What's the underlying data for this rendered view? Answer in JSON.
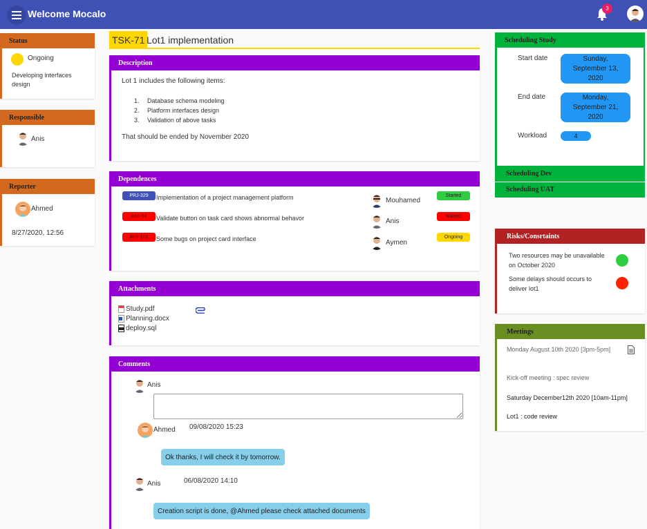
{
  "header": {
    "title": "Welcome Mocalo",
    "notification_count": "3"
  },
  "status": {
    "heading": "Status",
    "state": "Ongoing",
    "state_color": "#ffd700",
    "detail": "Developing interfaces design"
  },
  "responsible": {
    "heading": "Responsible",
    "name": "Anis"
  },
  "reporter": {
    "heading": "Reporter",
    "name": "Ahmed",
    "date": "8/27/2020, 12:56"
  },
  "task": {
    "id": "TSK-71",
    "name": "Lot1 implementation"
  },
  "description": {
    "heading": "Description",
    "intro": "Lot 1 includes the following items:",
    "items": [
      {
        "num": "1.",
        "text": "Database schema modeling"
      },
      {
        "num": "2.",
        "text": "Platform interfaces design"
      },
      {
        "num": "3.",
        "text": "Validation of above tasks"
      }
    ],
    "outro": "That should be ended by November 2020"
  },
  "dependences": {
    "heading": "Dependences",
    "rows": [
      {
        "code": "PRJ-329",
        "code_color": "#3f51b5",
        "text": "Implementation of a project management platform",
        "person": "Mouhamed",
        "status": "Started",
        "status_color": "#2ecc40"
      },
      {
        "code": "Ano-64",
        "code_color": "#ff0000",
        "text": "Validate button on task card shows abnormal behavor",
        "person": "Anis",
        "status": "Raised",
        "status_color": "#ff0000"
      },
      {
        "code": "Ano-101",
        "code_color": "#ff0000",
        "text": "Some bugs on project card interface",
        "person": "Aymen",
        "status": "Ongoing",
        "status_color": "#ffd700"
      }
    ]
  },
  "attachments": {
    "heading": "Attachments",
    "files": [
      {
        "name": "Study.pdf",
        "icon": "pdf-icon"
      },
      {
        "name": "Planning.docx",
        "icon": "docx-icon"
      },
      {
        "name": "deploy.sql",
        "icon": "sql-icon"
      }
    ]
  },
  "comments": {
    "heading": "Comments",
    "current_user": "Anis",
    "input_placeholder": "",
    "entries": [
      {
        "author": "Ahmed",
        "date": "09/08/2020 15:23",
        "text": "Ok thanks, I will check it by tomorrow."
      },
      {
        "author": "Anis",
        "date": "06/08/2020 14:10",
        "text": "Creation script is done, @Ahmed please check attached documents"
      }
    ]
  },
  "scheduling": {
    "study_heading": "Scheduling Study",
    "start_label": "Start date",
    "start_value": "Sunday, September 13, 2020",
    "end_label": "End date",
    "end_value": "Monday, September 21, 2020",
    "workload_label": "Workload",
    "workload_value": "4",
    "dev_heading": "Scheduling Dev",
    "uat_heading": "Scheduling UAT"
  },
  "risks": {
    "heading": "Risks/Consrtaints",
    "items": [
      {
        "text": "Two resources may be unavailable on October 2020",
        "color": "#2ecc40"
      },
      {
        "text": "Some delays should occurs to deliver lot1",
        "color": "#ff2200"
      }
    ]
  },
  "meetings": {
    "heading": "Meetings",
    "first_date": "Monday August 10th 2020 [3pm-5pm]",
    "first_title": "Kick-off meeting : spec review",
    "second_date": "Saturday December12th 2020 [10am-11pm]",
    "second_title": "Lot1 : code review"
  }
}
